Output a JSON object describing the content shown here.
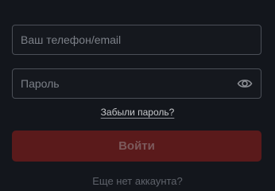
{
  "login_form": {
    "login_input": {
      "value": "",
      "placeholder": "Ваш телефон/email"
    },
    "password_input": {
      "value": "",
      "placeholder": "Пароль",
      "toggle_icon": "eye-icon"
    },
    "forgot_password_link": "Забыли пароль?",
    "submit_button": "Войти",
    "no_account_text": "Еще нет аккаунта?"
  },
  "colors": {
    "background": "#13161c",
    "field_border": "#4b4f57",
    "submit_bg": "#5a1a1b",
    "submit_text": "#7c5a5c"
  }
}
